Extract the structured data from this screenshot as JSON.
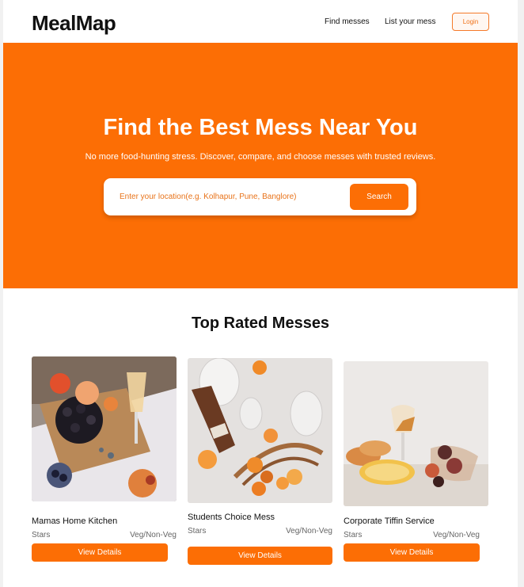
{
  "header": {
    "logo": "MealMap",
    "nav": {
      "find_messes": "Find messes",
      "list_your_mess": "List your mess"
    },
    "login_label": "Login"
  },
  "hero": {
    "title": "Find the Best Mess Near You",
    "subtitle": "No more food-hunting stress. Discover, compare, and choose messes with trusted reviews.",
    "search": {
      "placeholder": "Enter your location(e.g. Kolhapur, Pune, Banglore)",
      "value": "",
      "button_label": "Search"
    }
  },
  "top_rated": {
    "title": "Top Rated Messes",
    "cards": [
      {
        "name": "Mamas Home Kitchen",
        "stars_label": "Stars",
        "type": "Veg/Non-Veg",
        "button_label": "View Details"
      },
      {
        "name": "Students Choice Mess",
        "stars_label": "Stars",
        "type": "Veg/Non-Veg",
        "button_label": "View Details"
      },
      {
        "name": "Corporate Tiffin Service",
        "stars_label": "Stars",
        "type": "Veg/Non-Veg",
        "button_label": "View Details"
      }
    ]
  },
  "colors": {
    "accent": "#fc6e05",
    "background": "#ffffff",
    "text": "#111111"
  }
}
